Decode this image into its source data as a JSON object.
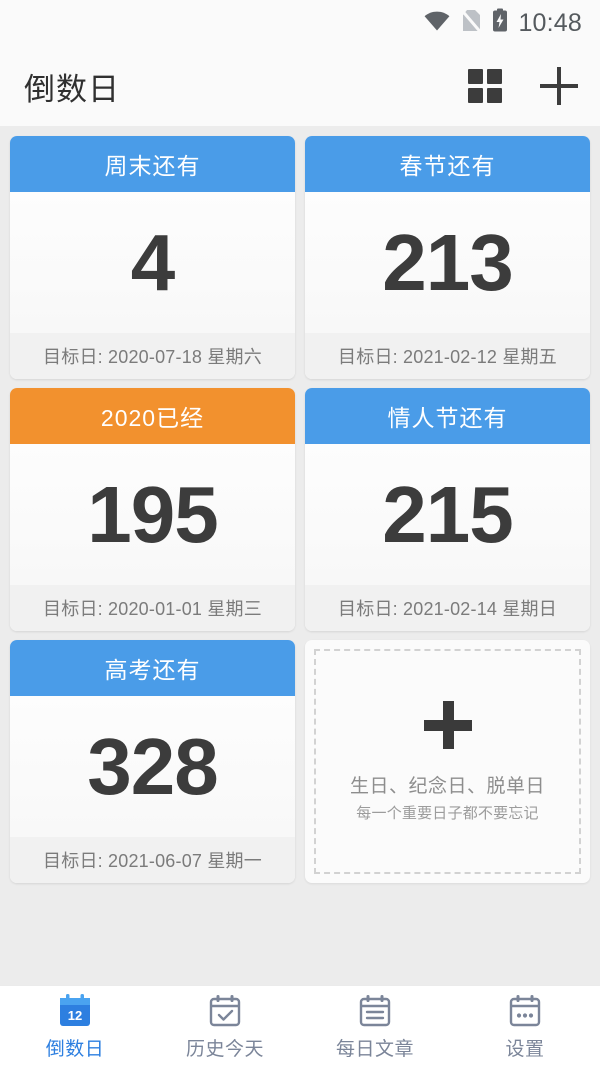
{
  "status_bar": {
    "time": "10:48",
    "icons": [
      "wifi-icon",
      "sim-card-off-icon",
      "battery-charging-icon"
    ]
  },
  "toolbar": {
    "title": "倒数日",
    "grid_view_icon": "grid-view-icon",
    "add_icon": "plus-icon"
  },
  "cards": [
    {
      "title": "周末还有",
      "number": "4",
      "footer": "目标日: 2020-07-18 星期六",
      "accent": "#4a9ce8",
      "accent_name": "blue"
    },
    {
      "title": "春节还有",
      "number": "213",
      "footer": "目标日: 2021-02-12 星期五",
      "accent": "#4a9ce8",
      "accent_name": "blue"
    },
    {
      "title": "2020已经",
      "number": "195",
      "footer": "目标日: 2020-01-01 星期三",
      "accent": "#f2912e",
      "accent_name": "orange"
    },
    {
      "title": "情人节还有",
      "number": "215",
      "footer": "目标日: 2021-02-14 星期日",
      "accent": "#4a9ce8",
      "accent_name": "blue"
    },
    {
      "title": "高考还有",
      "number": "328",
      "footer": "目标日: 2021-06-07 星期一",
      "accent": "#4a9ce8",
      "accent_name": "blue"
    }
  ],
  "add_card": {
    "icon": "plus-icon",
    "line1": "生日、纪念日、脱单日",
    "line2": "每一个重要日子都不要忘记"
  },
  "bottom_nav": {
    "active_index": 0,
    "active_color": "#2d7fe0",
    "inactive_color": "#7b8599",
    "items": [
      {
        "label": "倒数日",
        "icon": "calendar-12-icon",
        "badge": "12"
      },
      {
        "label": "历史今天",
        "icon": "calendar-check-icon"
      },
      {
        "label": "每日文章",
        "icon": "calendar-lines-icon"
      },
      {
        "label": "设置",
        "icon": "calendar-dots-icon"
      }
    ]
  }
}
